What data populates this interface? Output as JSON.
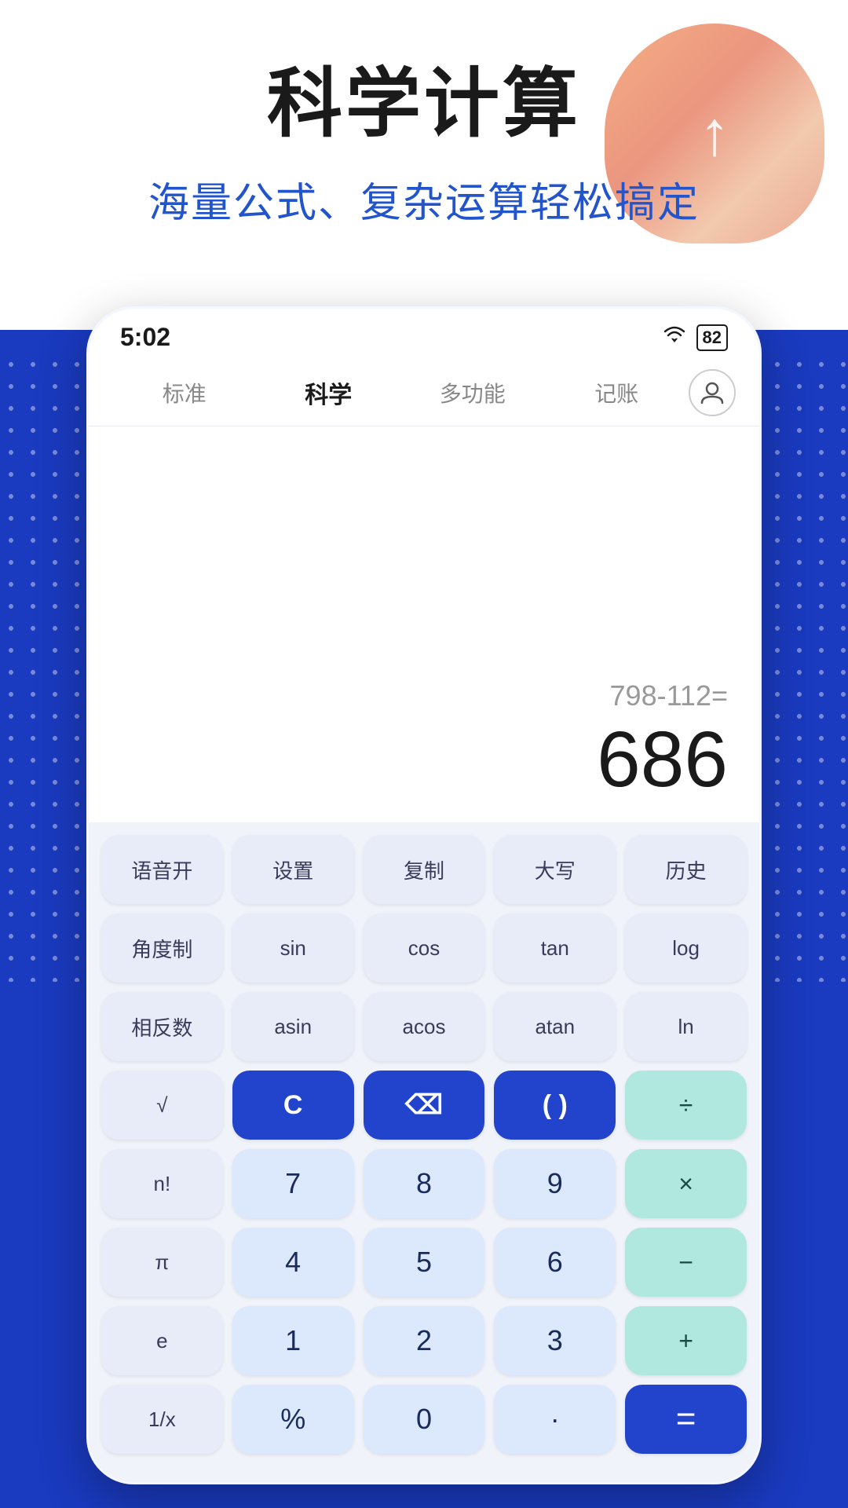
{
  "page": {
    "title": "科学计算",
    "subtitle": "海量公式、复杂运算轻松搞定"
  },
  "status": {
    "time": "5:02",
    "battery": "82",
    "wifi": "📶"
  },
  "nav": {
    "tabs": [
      "标准",
      "科学",
      "多功能",
      "记账"
    ],
    "active_tab": 1
  },
  "calculator": {
    "expression": "798-112=",
    "result": "686"
  },
  "keypad": {
    "row1": [
      {
        "label": "语音开",
        "type": "func"
      },
      {
        "label": "设置",
        "type": "func"
      },
      {
        "label": "复制",
        "type": "func"
      },
      {
        "label": "大写",
        "type": "func"
      },
      {
        "label": "历史",
        "type": "func"
      }
    ],
    "row2": [
      {
        "label": "角度制",
        "type": "func"
      },
      {
        "label": "sin",
        "type": "func"
      },
      {
        "label": "cos",
        "type": "func"
      },
      {
        "label": "tan",
        "type": "func"
      },
      {
        "label": "log",
        "type": "func"
      }
    ],
    "row3": [
      {
        "label": "相反数",
        "type": "func"
      },
      {
        "label": "asin",
        "type": "func"
      },
      {
        "label": "acos",
        "type": "func"
      },
      {
        "label": "atan",
        "type": "func"
      },
      {
        "label": "ln",
        "type": "func"
      }
    ],
    "row4": [
      {
        "label": "√",
        "type": "func"
      },
      {
        "label": "C",
        "type": "blue"
      },
      {
        "label": "⌫",
        "type": "blue"
      },
      {
        "label": "( )",
        "type": "blue"
      },
      {
        "label": "÷",
        "type": "teal"
      }
    ],
    "row5": [
      {
        "label": "n!",
        "type": "func"
      },
      {
        "label": "7",
        "type": "number"
      },
      {
        "label": "8",
        "type": "number"
      },
      {
        "label": "9",
        "type": "number"
      },
      {
        "label": "×",
        "type": "teal"
      }
    ],
    "row6": [
      {
        "label": "π",
        "type": "func"
      },
      {
        "label": "4",
        "type": "number"
      },
      {
        "label": "5",
        "type": "number"
      },
      {
        "label": "6",
        "type": "number"
      },
      {
        "label": "−",
        "type": "teal"
      }
    ],
    "row7": [
      {
        "label": "e",
        "type": "func"
      },
      {
        "label": "1",
        "type": "number"
      },
      {
        "label": "2",
        "type": "number"
      },
      {
        "label": "3",
        "type": "number"
      },
      {
        "label": "+",
        "type": "teal"
      }
    ],
    "row8": [
      {
        "label": "1/x",
        "type": "func"
      },
      {
        "label": "%",
        "type": "number"
      },
      {
        "label": "0",
        "type": "number"
      },
      {
        "label": "·",
        "type": "number"
      },
      {
        "label": "=",
        "type": "equals"
      }
    ]
  },
  "colors": {
    "brand_blue": "#2244cc",
    "bg_blue": "#1a3abf",
    "teal": "#b0e8e0",
    "light_number": "#dce8fc"
  }
}
